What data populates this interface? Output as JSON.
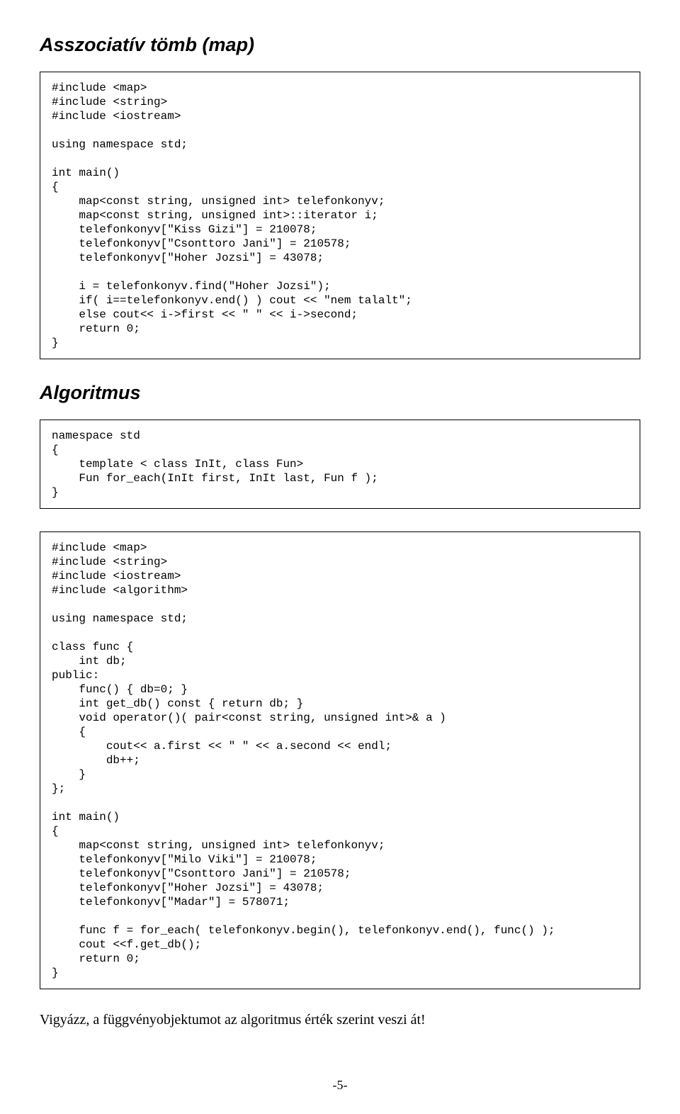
{
  "heading1": "Asszociatív tömb (map)",
  "code1": "#include <map>\n#include <string>\n#include <iostream>\n\nusing namespace std;\n\nint main()\n{\n    map<const string, unsigned int> telefonkonyv;\n    map<const string, unsigned int>::iterator i;\n    telefonkonyv[\"Kiss Gizi\"] = 210078;\n    telefonkonyv[\"Csonttoro Jani\"] = 210578;\n    telefonkonyv[\"Hoher Jozsi\"] = 43078;\n\n    i = telefonkonyv.find(\"Hoher Jozsi\");\n    if( i==telefonkonyv.end() ) cout << \"nem talalt\";\n    else cout<< i->first << \" \" << i->second;\n    return 0;\n}",
  "heading2": "Algoritmus",
  "code2": "namespace std\n{\n    template < class InIt, class Fun>\n    Fun for_each(InIt first, InIt last, Fun f );\n}",
  "code3": "#include <map>\n#include <string>\n#include <iostream>\n#include <algorithm>\n\nusing namespace std;\n\nclass func {\n    int db;\npublic:\n    func() { db=0; }\n    int get_db() const { return db; }\n    void operator()( pair<const string, unsigned int>& a )\n    {\n        cout<< a.first << \" \" << a.second << endl;\n        db++;\n    }\n};\n\nint main()\n{\n    map<const string, unsigned int> telefonkonyv;\n    telefonkonyv[\"Milo Viki\"] = 210078;\n    telefonkonyv[\"Csonttoro Jani\"] = 210578;\n    telefonkonyv[\"Hoher Jozsi\"] = 43078;\n    telefonkonyv[\"Madar\"] = 578071;\n\n    func f = for_each( telefonkonyv.begin(), telefonkonyv.end(), func() );\n    cout <<f.get_db();\n    return 0;\n}",
  "caption": "Vigyázz, a függvényobjektumot az algoritmus érték szerint veszi át!",
  "pagenum": "-5-"
}
